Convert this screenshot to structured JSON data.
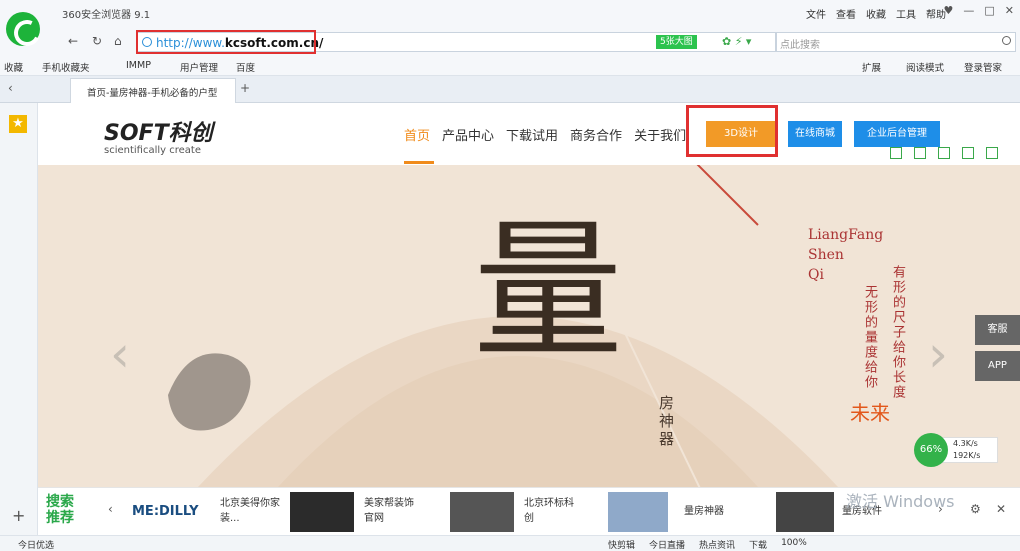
{
  "browser": {
    "app_title": "360安全浏览器 9.1",
    "menu": [
      "文件",
      "查看",
      "收藏",
      "工具",
      "帮助"
    ],
    "url": "http://www.",
    "url_domain": "kcsoft.com.cn/",
    "url_tag": "5张大图",
    "search_placeholder": "点此搜索",
    "bookmarks": [
      "收藏",
      "手机收藏夹",
      "IMMP",
      "用户管理",
      "百度"
    ],
    "bookmark_right": [
      "扩展",
      "阅读模式",
      "登录管家"
    ],
    "tab_title": "首页-量房神器-手机必备的户型"
  },
  "site": {
    "logo_text": "SOFT科创",
    "logo_sub": "scientifically create",
    "nav": [
      "首页",
      "产品中心",
      "下载试用",
      "商务合作",
      "关于我们"
    ],
    "btn_3d": "3D设计",
    "btn_shop": "在线商城",
    "btn_admin": "企业后台管理",
    "banner_char": "量",
    "banner_sub": "房神器",
    "lf": [
      "LiangFang",
      "Shen",
      "Qi"
    ],
    "vertical_1": "有形的尺子给你长度",
    "vertical_2": "无形的量度给你",
    "future": "未来",
    "side_tags": [
      "客服",
      "APP"
    ],
    "speed_pct": "66%",
    "speed_up": "4.3K/s",
    "speed_down": "192K/s"
  },
  "strip": {
    "head": [
      "搜索",
      "推荐"
    ],
    "items": [
      {
        "logo": "ME:DILLY",
        "text": "北京美得你家装..."
      },
      {
        "text": "美家帮装饰官网"
      },
      {
        "text": "北京环标科创"
      },
      {
        "text": "量房神器"
      },
      {
        "text": "量房软件"
      }
    ],
    "watermark": "激活 Windows"
  },
  "status": {
    "left": "今日优选",
    "right": [
      "快剪辑",
      "今日直播",
      "热点资讯",
      "下载",
      "100%"
    ]
  }
}
